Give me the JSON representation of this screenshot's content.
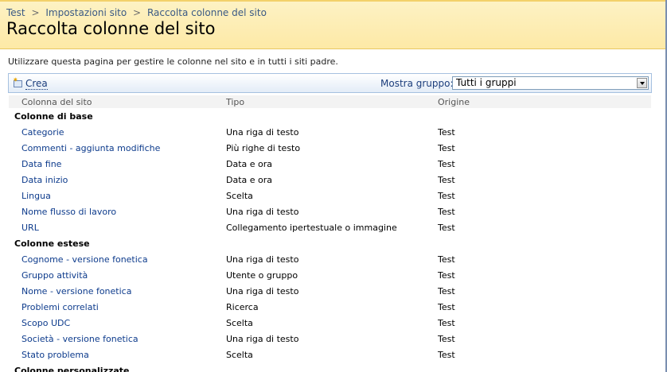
{
  "breadcrumb": {
    "items": [
      "Test",
      "Impostazioni sito",
      "Raccolta colonne del sito"
    ],
    "separator": ">"
  },
  "page_title": "Raccolta colonne del sito",
  "description": "Utilizzare questa pagina per gestire le colonne nel sito e in tutti i siti padre.",
  "toolbar": {
    "new_label": "Crea",
    "group_label": "Mostra gruppo:",
    "group_selected": "Tutti i gruppi"
  },
  "table": {
    "headers": [
      "Colonna del sito",
      "Tipo",
      "Origine"
    ],
    "groups": [
      {
        "title": "Colonne di base",
        "rows": [
          {
            "name": "Categorie",
            "type": "Una riga di testo",
            "origin": "Test"
          },
          {
            "name": "Commenti - aggiunta modifiche",
            "type": "Più righe di testo",
            "origin": "Test"
          },
          {
            "name": "Data fine",
            "type": "Data e ora",
            "origin": "Test"
          },
          {
            "name": "Data inizio",
            "type": "Data e ora",
            "origin": "Test"
          },
          {
            "name": "Lingua",
            "type": "Scelta",
            "origin": "Test"
          },
          {
            "name": "Nome flusso di lavoro",
            "type": "Una riga di testo",
            "origin": "Test"
          },
          {
            "name": "URL",
            "type": "Collegamento ipertestuale o immagine",
            "origin": "Test"
          }
        ]
      },
      {
        "title": "Colonne estese",
        "rows": [
          {
            "name": "Cognome - versione fonetica",
            "type": "Una riga di testo",
            "origin": "Test"
          },
          {
            "name": "Gruppo attività",
            "type": "Utente o gruppo",
            "origin": "Test"
          },
          {
            "name": "Nome - versione fonetica",
            "type": "Una riga di testo",
            "origin": "Test"
          },
          {
            "name": "Problemi correlati",
            "type": "Ricerca",
            "origin": "Test"
          },
          {
            "name": "Scopo UDC",
            "type": "Scelta",
            "origin": "Test"
          },
          {
            "name": "Società - versione fonetica",
            "type": "Una riga di testo",
            "origin": "Test"
          },
          {
            "name": "Stato problema",
            "type": "Scelta",
            "origin": "Test"
          }
        ]
      },
      {
        "title": "Colonne personalizzate",
        "rows": []
      }
    ]
  },
  "colors": {
    "title_bg": "#fdefb8",
    "link": "#0d3b8c",
    "toolbar_border": "#a6c1e0"
  }
}
